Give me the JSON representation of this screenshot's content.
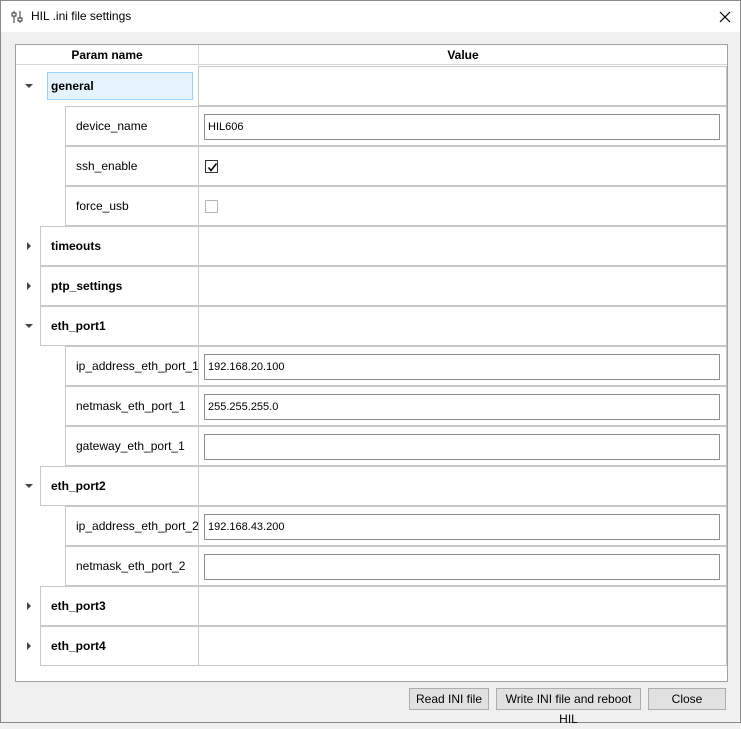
{
  "window": {
    "title": "HIL .ini file settings",
    "icon": "sliders-icon",
    "close_icon": "close-icon"
  },
  "table": {
    "headers": [
      "Param name",
      "Value"
    ],
    "rows": [
      {
        "type": "group",
        "label": "general",
        "expanded": true,
        "selected": true
      },
      {
        "type": "text",
        "label": "device_name",
        "value": "HIL606"
      },
      {
        "type": "check",
        "label": "ssh_enable",
        "checked": true
      },
      {
        "type": "check",
        "label": "force_usb",
        "checked": false
      },
      {
        "type": "group",
        "label": "timeouts",
        "expanded": false
      },
      {
        "type": "group",
        "label": "ptp_settings",
        "expanded": false
      },
      {
        "type": "group",
        "label": "eth_port1",
        "expanded": true
      },
      {
        "type": "text",
        "label": "ip_address_eth_port_1",
        "value": "192.168.20.100"
      },
      {
        "type": "text",
        "label": "netmask_eth_port_1",
        "value": "255.255.255.0"
      },
      {
        "type": "text",
        "label": "gateway_eth_port_1",
        "value": ""
      },
      {
        "type": "group",
        "label": "eth_port2",
        "expanded": true
      },
      {
        "type": "text",
        "label": "ip_address_eth_port_2",
        "value": "192.168.43.200"
      },
      {
        "type": "text",
        "label": "netmask_eth_port_2",
        "value": ""
      },
      {
        "type": "group",
        "label": "eth_port3",
        "expanded": false
      },
      {
        "type": "group",
        "label": "eth_port4",
        "expanded": false
      }
    ]
  },
  "buttons": {
    "read": "Read INI file",
    "write": "Write INI file and reboot HIL",
    "close": "Close"
  },
  "colors": {
    "selection_fill": "#e5f3ff",
    "selection_border": "#99d1ff",
    "button_bg": "#e1e1e1"
  }
}
